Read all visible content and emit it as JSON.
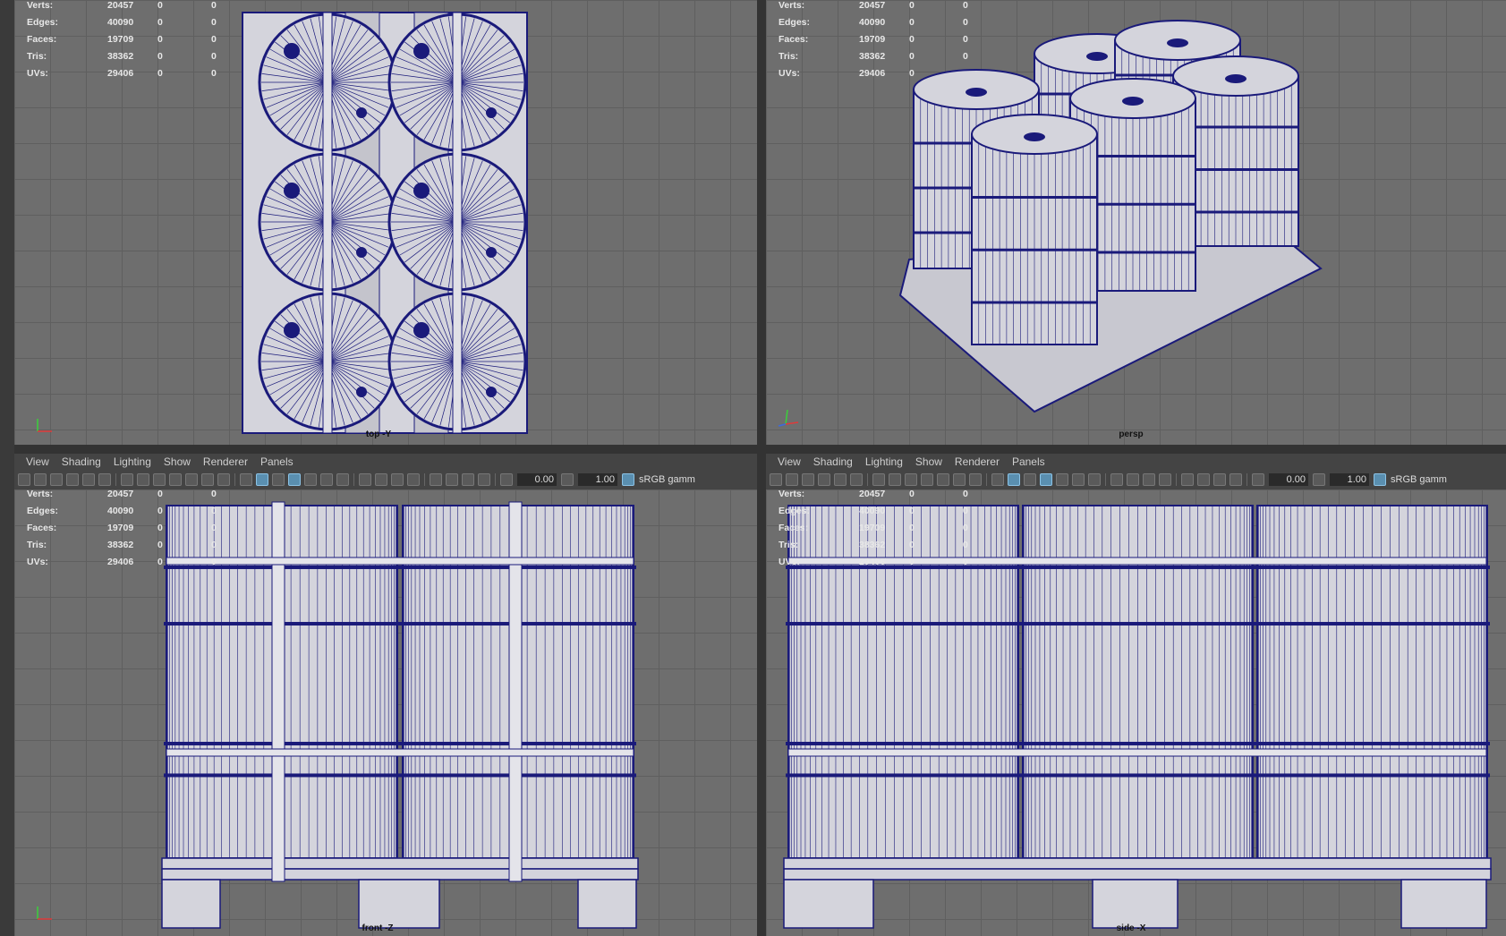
{
  "menus": [
    "View",
    "Shading",
    "Lighting",
    "Show",
    "Renderer",
    "Panels"
  ],
  "toolbar": {
    "exposure": "0.00",
    "gamma": "1.00",
    "color_space": "sRGB gamm"
  },
  "hud": {
    "rows": [
      {
        "label": "Verts:",
        "value": "20457",
        "sel": "0",
        "comp": "0"
      },
      {
        "label": "Edges:",
        "value": "40090",
        "sel": "0",
        "comp": "0"
      },
      {
        "label": "Faces:",
        "value": "19709",
        "sel": "0",
        "comp": "0"
      },
      {
        "label": "Tris:",
        "value": "38362",
        "sel": "0",
        "comp": "0"
      },
      {
        "label": "UVs:",
        "value": "29406",
        "sel": "0",
        "comp": "0"
      }
    ]
  },
  "viewports": {
    "top": {
      "camera": "top -Y"
    },
    "persp": {
      "camera": "persp"
    },
    "front": {
      "camera": "front -Z"
    },
    "side": {
      "camera": "side -X"
    }
  },
  "colors": {
    "wire": "#1a1a7a",
    "mesh": "#d4d4dc",
    "grid_bg": "#6e6e6e",
    "ui_bg": "#444444"
  }
}
